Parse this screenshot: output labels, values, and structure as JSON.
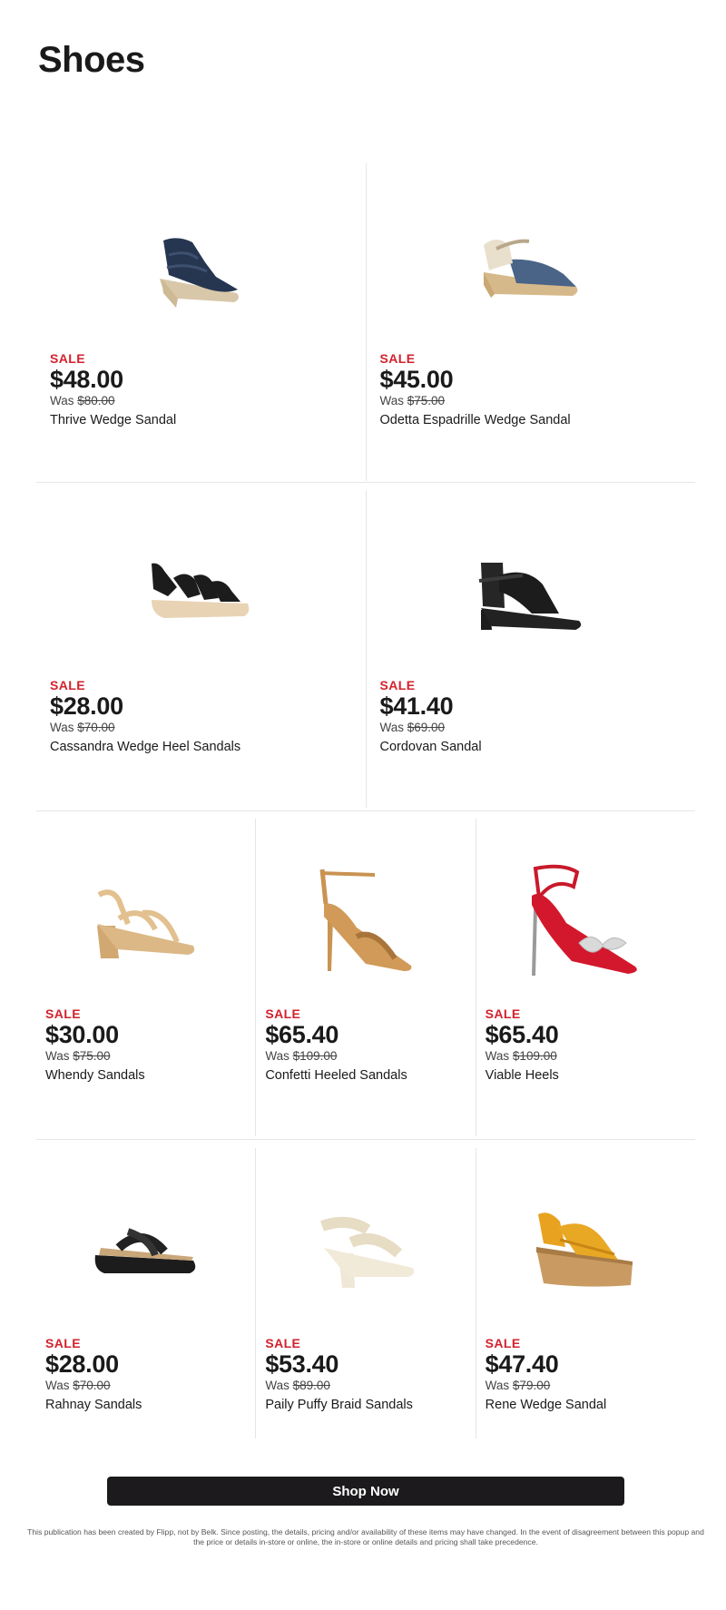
{
  "page": {
    "title": "Shoes",
    "shop_button": "Shop Now",
    "disclaimer": "This publication has been created by Flipp, not by Belk. Since posting, the details, pricing and/or availability of these items may have changed. In the event of disagreement between this popup and the price or details in-store or online, the in-store or online details and pricing shall take precedence.",
    "sale_color": "#d3212d"
  },
  "products": [
    {
      "sale": "SALE",
      "price": "$48.00",
      "was_label": "Was",
      "was_price": "$80.00",
      "name": "Thrive Wedge Sandal"
    },
    {
      "sale": "SALE",
      "price": "$45.00",
      "was_label": "Was",
      "was_price": "$75.00",
      "name": "Odetta Espadrille Wedge Sandal"
    },
    {
      "sale": "SALE",
      "price": "$28.00",
      "was_label": "Was",
      "was_price": "$70.00",
      "name": "Cassandra Wedge Heel Sandals"
    },
    {
      "sale": "SALE",
      "price": "$41.40",
      "was_label": "Was",
      "was_price": "$69.00",
      "name": "Cordovan Sandal"
    },
    {
      "sale": "SALE",
      "price": "$30.00",
      "was_label": "Was",
      "was_price": "$75.00",
      "name": "Whendy Sandals"
    },
    {
      "sale": "SALE",
      "price": "$65.40",
      "was_label": "Was",
      "was_price": "$109.00",
      "name": "Confetti Heeled Sandals"
    },
    {
      "sale": "SALE",
      "price": "$65.40",
      "was_label": "Was",
      "was_price": "$109.00",
      "name": "Viable Heels"
    },
    {
      "sale": "SALE",
      "price": "$28.00",
      "was_label": "Was",
      "was_price": "$70.00",
      "name": "Rahnay Sandals"
    },
    {
      "sale": "SALE",
      "price": "$53.40",
      "was_label": "Was",
      "was_price": "$89.00",
      "name": "Paily Puffy Braid Sandals"
    },
    {
      "sale": "SALE",
      "price": "$47.40",
      "was_label": "Was",
      "was_price": "$79.00",
      "name": "Rene Wedge Sandal"
    }
  ]
}
